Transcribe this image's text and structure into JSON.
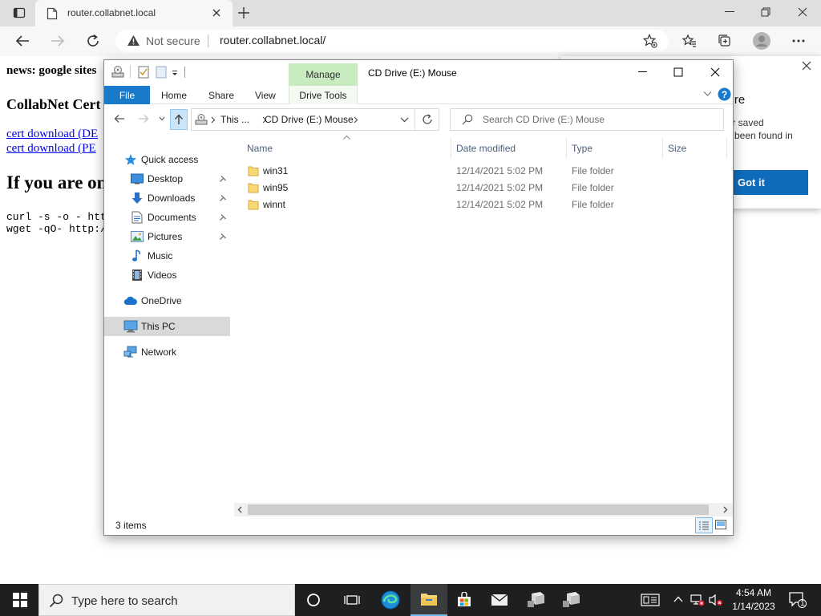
{
  "browser": {
    "tab_title": "router.collabnet.local",
    "not_secure": "Not secure",
    "url": "router.collabnet.local/"
  },
  "webpage": {
    "news": "news: google sites",
    "cert_heading": "CollabNet Cert",
    "link1": "cert download (DE",
    "link2": "cert download (PE",
    "heading2": "If you are on",
    "cmd1": "curl -s -o - http",
    "cmd2": "wget -qO- http://"
  },
  "popup": {
    "title": "cure",
    "line1": "our saved",
    "line2": "ve been found in",
    "button": "Got it"
  },
  "explorer": {
    "window_title": "CD Drive (E:) Mouse",
    "ribbon": {
      "manage": "Manage",
      "file": "File",
      "home": "Home",
      "share": "Share",
      "view": "View",
      "drive_tools": "Drive Tools"
    },
    "address": {
      "part1": "This ...",
      "part2": "CD Drive (E:) Mouse"
    },
    "search_placeholder": "Search CD Drive (E:) Mouse",
    "nav": {
      "quick_access": "Quick access",
      "desktop": "Desktop",
      "downloads": "Downloads",
      "documents": "Documents",
      "pictures": "Pictures",
      "music": "Music",
      "videos": "Videos",
      "onedrive": "OneDrive",
      "this_pc": "This PC",
      "network": "Network"
    },
    "columns": {
      "name": "Name",
      "date": "Date modified",
      "type": "Type",
      "size": "Size"
    },
    "files": [
      {
        "name": "win31",
        "date": "12/14/2021 5:02 PM",
        "type": "File folder"
      },
      {
        "name": "win95",
        "date": "12/14/2021 5:02 PM",
        "type": "File folder"
      },
      {
        "name": "winnt",
        "date": "12/14/2021 5:02 PM",
        "type": "File folder"
      }
    ],
    "status": "3 items"
  },
  "taskbar": {
    "search_placeholder": "Type here to search",
    "time": "4:54 AM",
    "date": "1/14/2023",
    "notification_count": "1"
  },
  "colors": {
    "accent": "#0f6cbd",
    "ribbon_file": "#1979ca",
    "manage_tab": "#c9ebc0",
    "folder": "#f8d775",
    "taskbar": "#1e1f21"
  }
}
